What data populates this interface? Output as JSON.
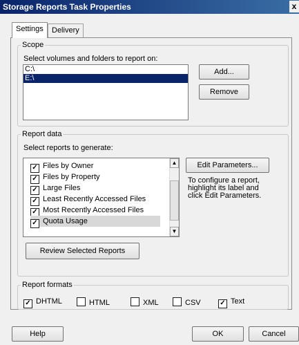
{
  "window": {
    "title": "Storage Reports Task Properties",
    "close_glyph": "x"
  },
  "tabs": [
    {
      "label": "Settings",
      "active": true
    },
    {
      "label": "Delivery",
      "active": false
    }
  ],
  "scope": {
    "legend": "Scope",
    "prompt": "Select volumes and folders to report on:",
    "volumes": [
      "C:\\",
      "E:\\"
    ],
    "selected_volume": "E:\\",
    "add_label": "Add...",
    "remove_label": "Remove"
  },
  "report_data": {
    "legend": "Report data",
    "prompt": "Select reports to generate:",
    "reports": [
      {
        "label": "Files by Owner",
        "checked": true
      },
      {
        "label": "Files by Property",
        "checked": true
      },
      {
        "label": "Large Files",
        "checked": true
      },
      {
        "label": "Least Recently Accessed Files",
        "checked": true
      },
      {
        "label": "Most Recently Accessed Files",
        "checked": true
      },
      {
        "label": "Quota Usage",
        "checked": true
      }
    ],
    "edit_parameters_label": "Edit Parameters...",
    "help_text": "To configure a report, highlight its label and click Edit Parameters.",
    "review_label": "Review Selected Reports",
    "scroll_up_glyph": "▲",
    "scroll_down_glyph": "▼"
  },
  "report_formats": {
    "legend": "Report formats",
    "formats": [
      {
        "label": "DHTML",
        "checked": true
      },
      {
        "label": "HTML",
        "checked": false
      },
      {
        "label": "XML",
        "checked": false
      },
      {
        "label": "CSV",
        "checked": false
      },
      {
        "label": "Text",
        "checked": true
      }
    ]
  },
  "footer": {
    "help_label": "Help",
    "ok_label": "OK",
    "cancel_label": "Cancel"
  },
  "check_glyph": "✓"
}
